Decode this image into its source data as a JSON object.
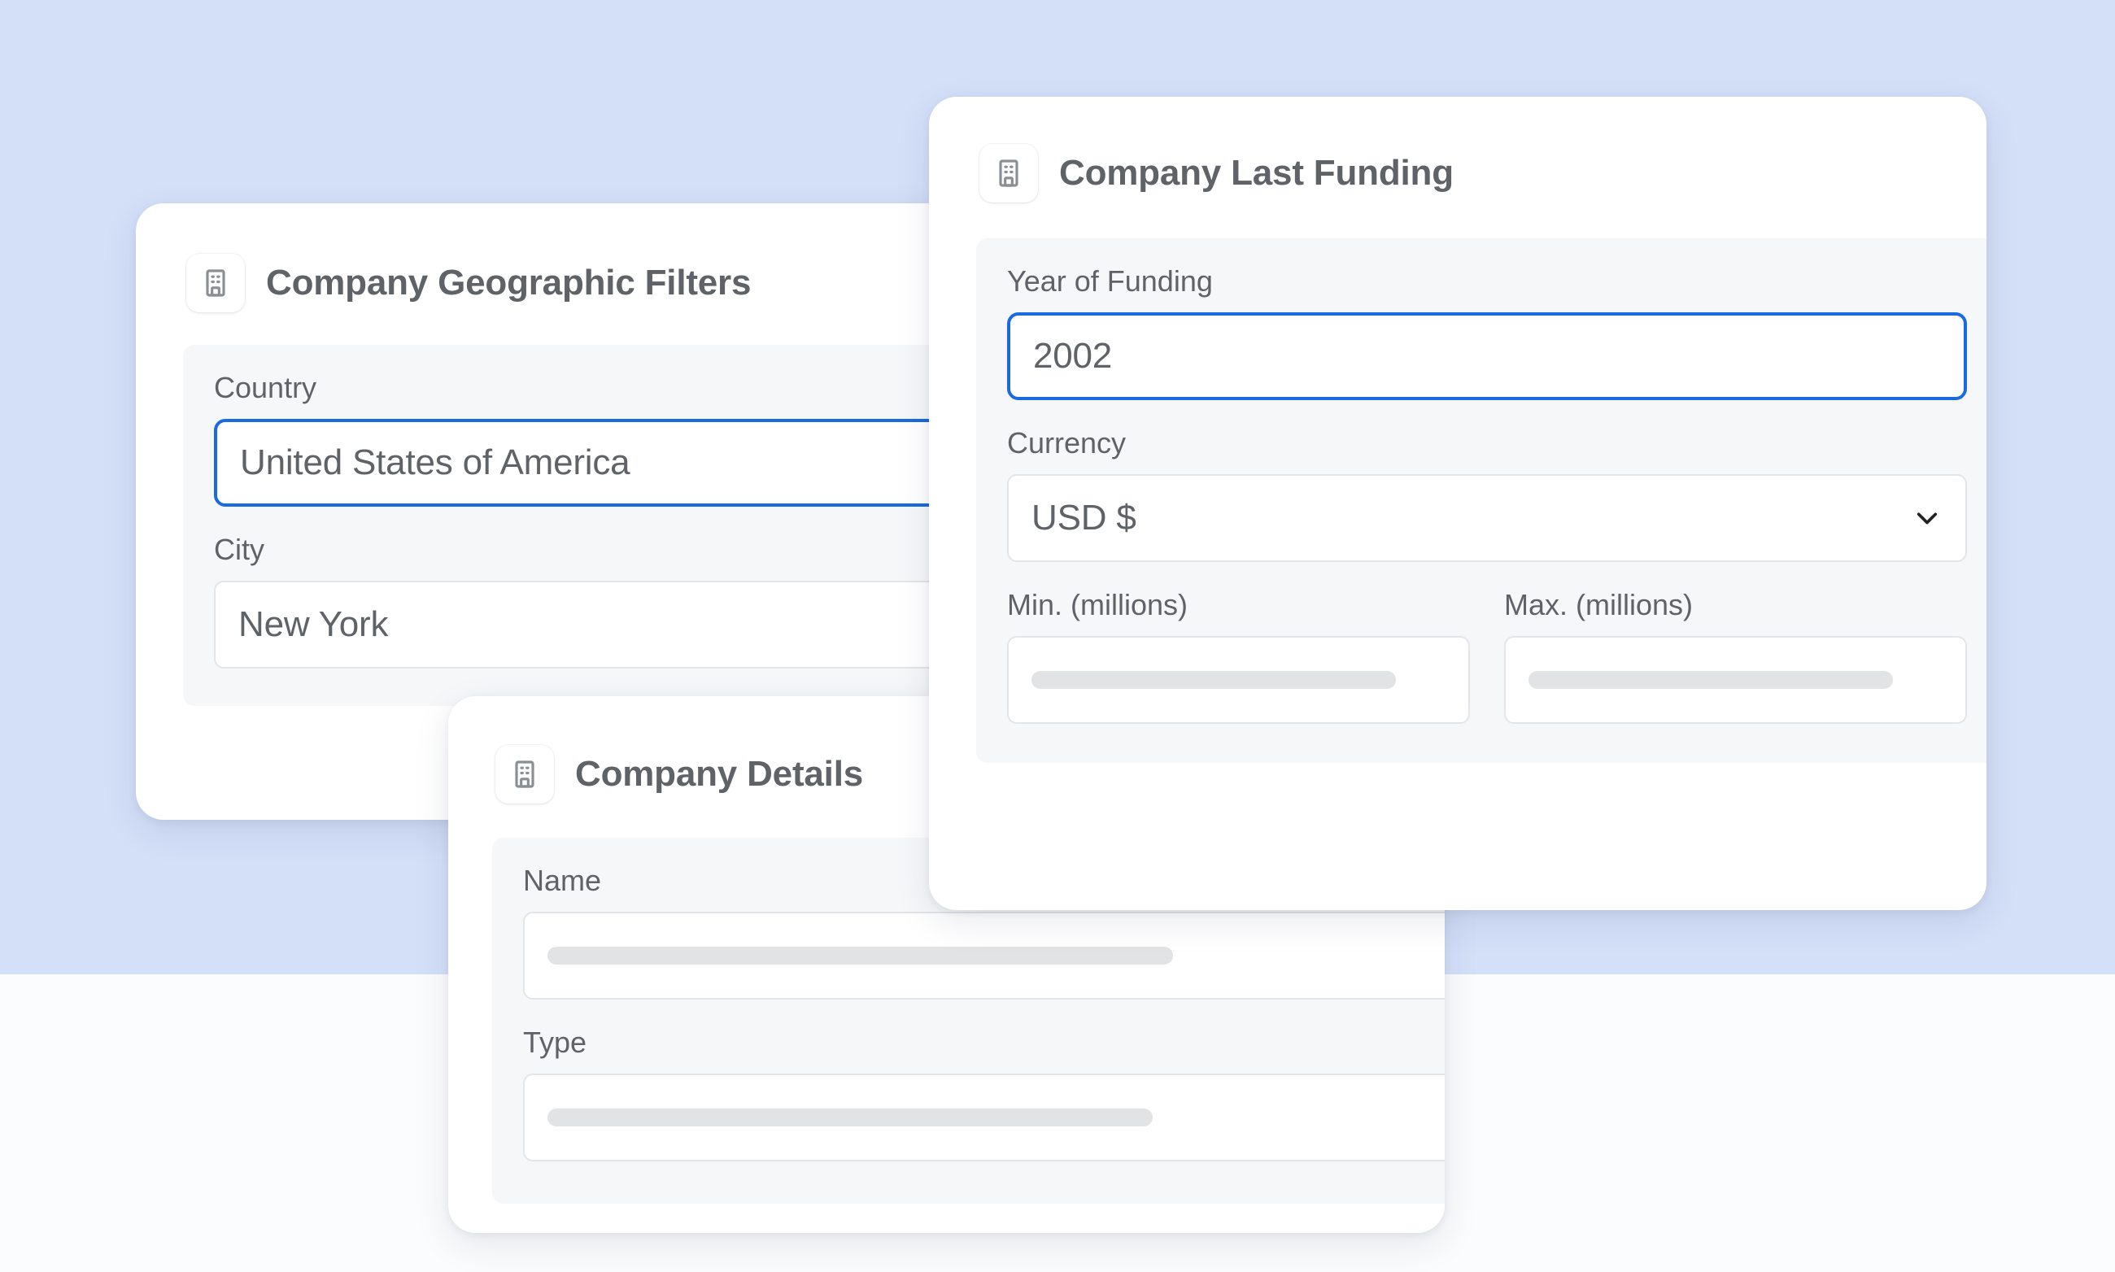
{
  "theme": {
    "page_background": "#fbfcfd",
    "band_color": "#d4e0f8",
    "card_background": "#ffffff",
    "panel_background": "#f6f7f9",
    "accent_focus_blue": "#1a6ae0",
    "label_text": "#5f6368",
    "value_text": "#5f6368",
    "input_border": "#e3e5e8",
    "skeleton_bar": "#e2e3e5"
  },
  "cards": {
    "geographic": {
      "title": "Company Geographic Filters",
      "icon": "building-icon",
      "fields": [
        {
          "label": "Country",
          "value": "United States of America",
          "placeholder": "",
          "focused": true,
          "empty": false
        },
        {
          "label": "City",
          "value": "New York",
          "placeholder": "",
          "focused": false,
          "empty": false
        }
      ]
    },
    "details": {
      "title": "Company Details",
      "icon": "building-icon",
      "fields": [
        {
          "label": "Name",
          "value": "",
          "placeholder": "",
          "focused": false,
          "empty": true
        },
        {
          "label": "Type",
          "value": "",
          "placeholder": "",
          "focused": false,
          "empty": true
        }
      ]
    },
    "funding": {
      "title": "Company Last Funding",
      "icon": "building-icon",
      "fields": [
        {
          "label": "Year of Funding",
          "value": "2002",
          "placeholder": "",
          "focused": true,
          "empty": false
        },
        {
          "label": "Currency",
          "value": "USD $",
          "placeholder": "",
          "focused": false,
          "empty": false,
          "control": "select",
          "chevron_icon": "chevron-down-icon"
        },
        {
          "label": "Min. (millions)",
          "value": "",
          "placeholder": "",
          "focused": false,
          "empty": true
        },
        {
          "label": "Max. (millions)",
          "value": "",
          "placeholder": "",
          "focused": false,
          "empty": true
        }
      ]
    }
  }
}
